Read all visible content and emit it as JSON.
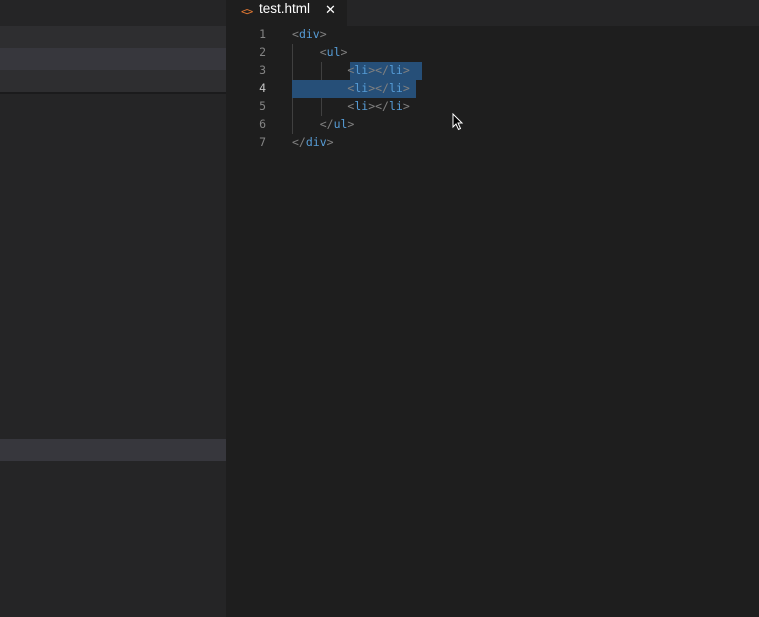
{
  "tab": {
    "icon": "code-brackets-icon",
    "icon_glyph": "<>",
    "label": "test.html",
    "close_glyph": "✕"
  },
  "lines": [
    {
      "num": "1",
      "indent": "",
      "open": "<",
      "tag": "div",
      "close": ">"
    },
    {
      "num": "2",
      "indent": "    ",
      "open": "<",
      "tag": "ul",
      "close": ">"
    },
    {
      "num": "3",
      "indent": "        ",
      "open": "<",
      "tag": "li",
      "close": "></",
      "tag2": "li",
      "close2": ">"
    },
    {
      "num": "4",
      "indent": "        ",
      "open": "<",
      "tag": "li",
      "close": "></",
      "tag2": "li",
      "close2": ">"
    },
    {
      "num": "5",
      "indent": "        ",
      "open": "<",
      "tag": "li",
      "close": "></",
      "tag2": "li",
      "close2": ">"
    },
    {
      "num": "6",
      "indent": "    ",
      "open": "</",
      "tag": "ul",
      "close": ">"
    },
    {
      "num": "7",
      "indent": "",
      "open": "</",
      "tag": "div",
      "close": ">"
    }
  ],
  "colors": {
    "tag": "#569cd6",
    "punctuation": "#808080",
    "selection": "#264f78",
    "tab_icon": "#e37933"
  }
}
